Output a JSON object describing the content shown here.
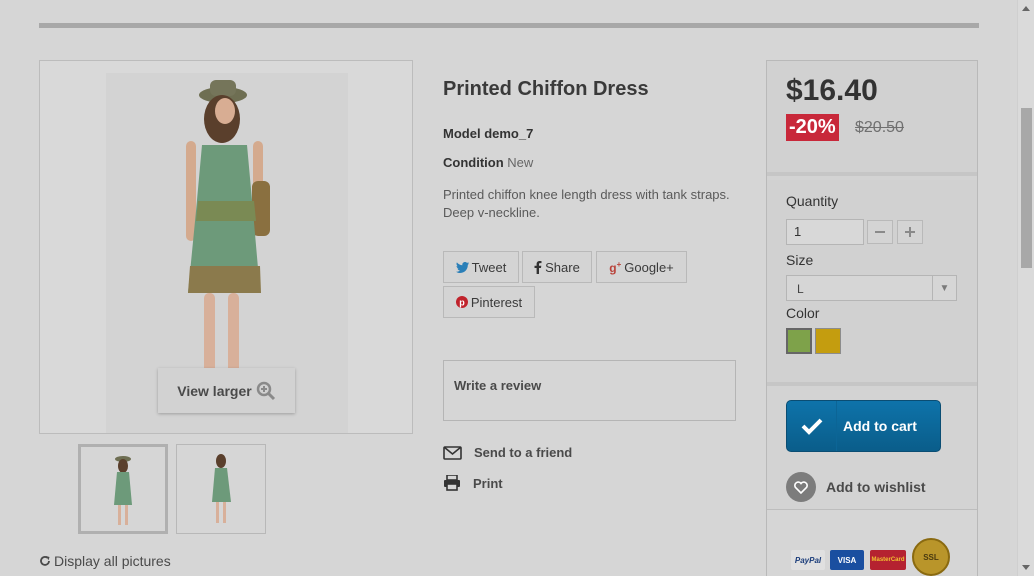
{
  "product": {
    "name": "Printed Chiffon Dress",
    "model_label": "Model",
    "model_value": "demo_7",
    "condition_label": "Condition",
    "condition_value": "New",
    "description": "Printed chiffon knee length dress with tank straps. Deep v-neckline."
  },
  "gallery": {
    "view_larger": "View larger",
    "display_all": "Display all pictures"
  },
  "share": {
    "tweet": "Tweet",
    "share": "Share",
    "google": "Google+",
    "pinterest": "Pinterest"
  },
  "review": {
    "label": "Write a review"
  },
  "actions": {
    "send_friend": "Send to a friend",
    "print": "Print"
  },
  "buy": {
    "price": "$16.40",
    "discount": "-20%",
    "old_price": "$20.50",
    "quantity_label": "Quantity",
    "quantity_value": "1",
    "size_label": "Size",
    "size_value": "L",
    "color_label": "Color",
    "colors": [
      "#7ea24a",
      "#c49d0f"
    ],
    "add_to_cart": "Add to cart",
    "wishlist": "Add to wishlist",
    "payment": [
      "PayPal",
      "VISA",
      "MasterCard",
      "SSL"
    ]
  }
}
